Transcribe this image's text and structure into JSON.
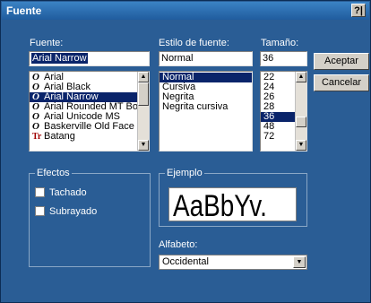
{
  "dialog": {
    "title": "Fuente",
    "help": "?|"
  },
  "font": {
    "label": "Fuente:",
    "value": "Arial Narrow",
    "items": [
      {
        "icon": "O",
        "name": "Arial"
      },
      {
        "icon": "O",
        "name": "Arial Black"
      },
      {
        "icon": "O",
        "name": "Arial Narrow"
      },
      {
        "icon": "O",
        "name": "Arial Rounded MT Bold"
      },
      {
        "icon": "O",
        "name": "Arial Unicode MS"
      },
      {
        "icon": "O",
        "name": "Baskerville Old Face"
      },
      {
        "icon": "Tr",
        "name": "Batang"
      }
    ],
    "selected_index": 2
  },
  "style": {
    "label": "Estilo de fuente:",
    "value": "Normal",
    "items": [
      "Normal",
      "Cursiva",
      "Negrita",
      "Negrita cursiva"
    ],
    "selected_index": 0
  },
  "size": {
    "label": "Tamaño:",
    "value": "36",
    "items": [
      "22",
      "24",
      "26",
      "28",
      "36",
      "48",
      "72"
    ],
    "selected_index": 4
  },
  "buttons": {
    "ok": "Aceptar",
    "cancel": "Cancelar"
  },
  "effects": {
    "label": "Efectos",
    "strikeout": "Tachado",
    "underline": "Subrayado"
  },
  "sample": {
    "label": "Ejemplo",
    "text": "AaBbYv."
  },
  "script": {
    "label": "Alfabeto:",
    "value": "Occidental"
  }
}
